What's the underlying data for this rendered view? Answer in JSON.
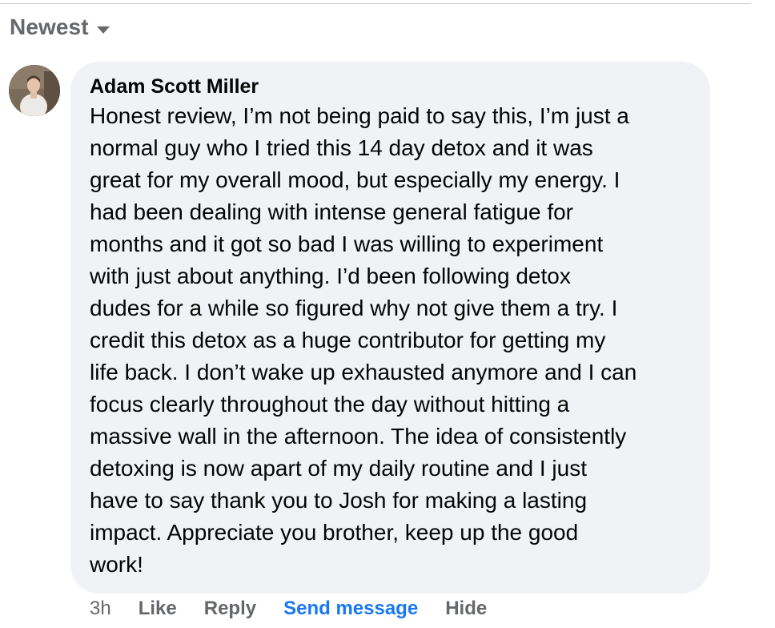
{
  "sort": {
    "label": "Newest",
    "icon": "caret-down-icon"
  },
  "comment": {
    "avatar_icon": "user-avatar",
    "author": "Adam Scott Miller",
    "lines": [
      "Honest review, I’m not being paid to say this, I’m just a",
      "normal guy who I tried this 14 day detox and it was",
      "great for my overall mood, but especially my energy. I",
      "had been dealing with intense general fatigue for",
      "months and it got so bad I was willing to experiment",
      "with just about anything. I’d been following detox",
      "dudes for a while so figured why not give them a try. I",
      "credit this detox as a huge contributor for getting my",
      "life back. I don’t wake up exhausted anymore and I can",
      "focus clearly throughout the day without hitting a",
      "massive wall in the afternoon. The idea of consistently",
      "detoxing is now apart of my daily routine and I just",
      "have to say thank you to Josh for making a lasting",
      "impact. Appreciate you brother, keep up the good",
      "work!"
    ],
    "time": "3h",
    "actions": {
      "like": "Like",
      "reply": "Reply",
      "send_message": "Send message",
      "hide": "Hide"
    }
  },
  "colors": {
    "bubble": "#f0f2f5",
    "secondary_text": "#65676b",
    "primary_text": "#050505",
    "accent": "#1877f2"
  }
}
